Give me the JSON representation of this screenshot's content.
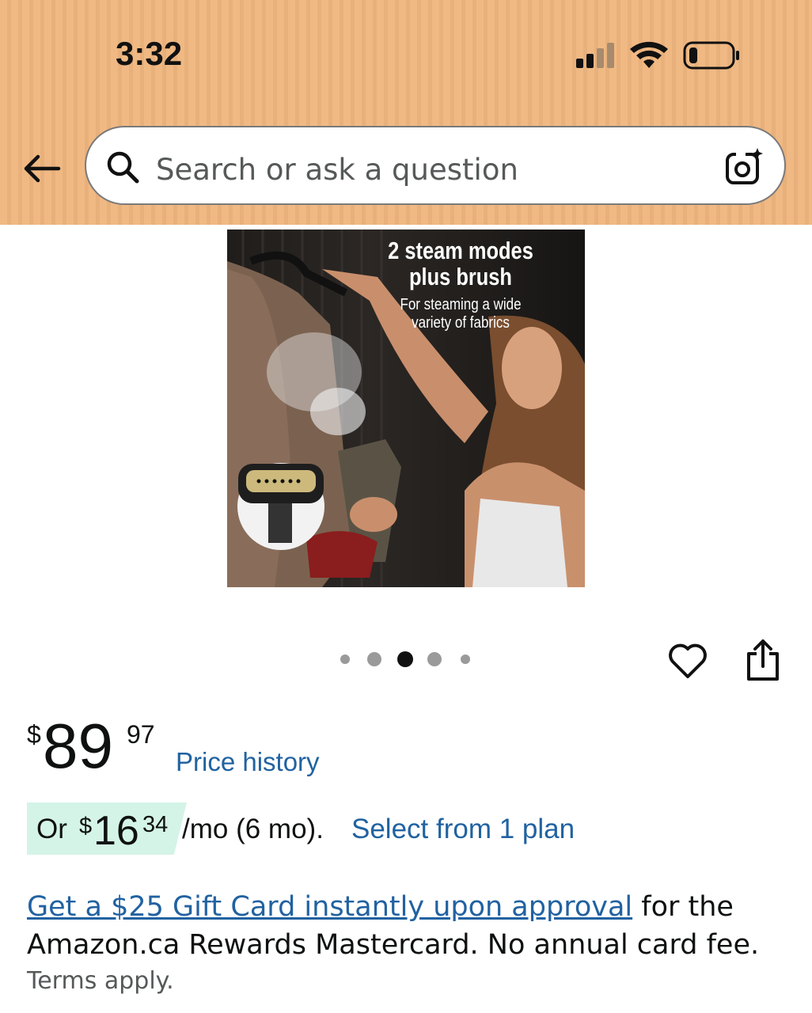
{
  "status_bar": {
    "time": "3:32"
  },
  "search": {
    "placeholder": "Search or ask a question"
  },
  "product_image": {
    "headline_line1": "2 steam modes",
    "headline_line2": "plus brush",
    "sub_line1": "For steaming a wide",
    "sub_line2": "variety of fabrics"
  },
  "carousel": {
    "dot_count": 5,
    "active_index": 2
  },
  "price": {
    "currency": "$",
    "whole": "89",
    "fraction": "97",
    "history_label": "Price history"
  },
  "installment": {
    "prefix": "Or",
    "currency": "$",
    "whole": "16",
    "fraction": "34",
    "term": "/mo (6 mo).",
    "link": "Select from 1 plan"
  },
  "promo": {
    "link": "Get a $25 Gift Card instantly upon approval",
    "text": " for the Amazon.ca Rewards Mastercard. No annual card fee.",
    "terms": "Terms apply."
  },
  "colors": {
    "header_bg": "#f0b983",
    "link": "#2162a1",
    "installment_bg": "#d4f4e7"
  }
}
